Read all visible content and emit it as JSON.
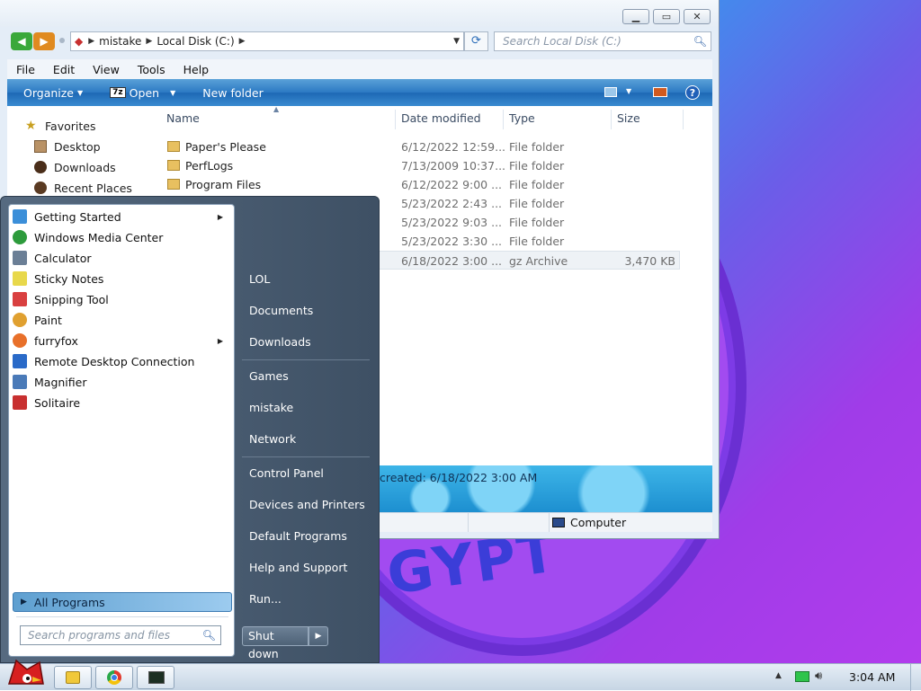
{
  "explorer": {
    "address": {
      "crumbs": [
        "mistake",
        "Local Disk (C:)"
      ]
    },
    "search_placeholder": "Search Local Disk (C:)",
    "menu": [
      "File",
      "Edit",
      "View",
      "Tools",
      "Help"
    ],
    "toolbar": {
      "organize": "Organize",
      "open": "Open",
      "open_icon": "7z",
      "new_folder": "New folder"
    },
    "favorites": {
      "header": "Favorites",
      "items": [
        "Desktop",
        "Downloads",
        "Recent Places"
      ]
    },
    "columns": {
      "name": "Name",
      "date": "Date modified",
      "type": "Type",
      "size": "Size"
    },
    "files": [
      {
        "name": "Paper's Please",
        "date": "6/12/2022 12:59...",
        "type": "File folder",
        "size": ""
      },
      {
        "name": "PerfLogs",
        "date": "7/13/2009 10:37...",
        "type": "File folder",
        "size": ""
      },
      {
        "name": "Program Files",
        "date": "6/12/2022 9:00 ...",
        "type": "File folder",
        "size": ""
      },
      {
        "name": "",
        "date": "5/23/2022 2:43 ...",
        "type": "File folder",
        "size": ""
      },
      {
        "name": "",
        "date": "5/23/2022 9:03 ...",
        "type": "File folder",
        "size": ""
      },
      {
        "name": "",
        "date": "5/23/2022 3:30 ...",
        "type": "File folder",
        "size": ""
      },
      {
        "name": "",
        "date": "6/18/2022 3:00 ...",
        "type": "gz Archive",
        "size": "3,470 KB"
      }
    ],
    "details": "created: 6/18/2022 3:00 AM",
    "status_computer": "Computer"
  },
  "start_menu": {
    "programs": [
      {
        "label": "Getting Started",
        "submenu": true,
        "color": "#3b8fd9"
      },
      {
        "label": "Windows Media Center",
        "submenu": false,
        "color": "#2d9b3c"
      },
      {
        "label": "Calculator",
        "submenu": false,
        "color": "#6b7f96"
      },
      {
        "label": "Sticky Notes",
        "submenu": false,
        "color": "#e8d84b"
      },
      {
        "label": "Snipping Tool",
        "submenu": false,
        "color": "#d94040"
      },
      {
        "label": "Paint",
        "submenu": false,
        "color": "#e0a030"
      },
      {
        "label": "furryfox",
        "submenu": true,
        "color": "#e8702a"
      },
      {
        "label": "Remote Desktop Connection",
        "submenu": false,
        "color": "#2a6ac8"
      },
      {
        "label": "Magnifier",
        "submenu": false,
        "color": "#4a7ab8"
      },
      {
        "label": "Solitaire",
        "submenu": false,
        "color": "#c83030"
      }
    ],
    "all_programs": "All Programs",
    "search_placeholder": "Search programs and files",
    "right": [
      "LOL",
      "Documents",
      "Downloads",
      "Games",
      "mistake",
      "Network",
      "Control Panel",
      "Devices and Printers",
      "Default Programs",
      "Help and Support",
      "Run..."
    ],
    "shutdown": "Shut down"
  },
  "taskbar": {
    "clock": "3:04 AM"
  },
  "wallpaper": {
    "text": "GYPT"
  }
}
